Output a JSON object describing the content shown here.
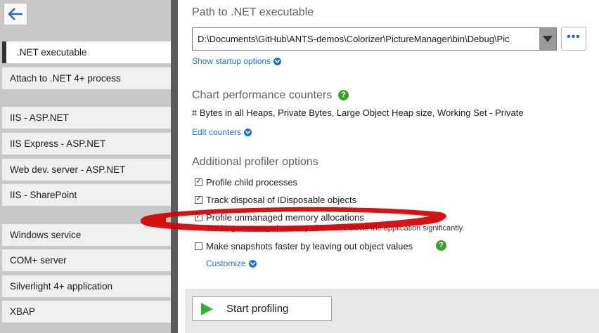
{
  "sidebar": {
    "items": [
      {
        "label": ".NET executable",
        "active": true
      },
      {
        "label": "Attach to .NET 4+ process"
      },
      {
        "label": "IIS - ASP.NET"
      },
      {
        "label": "IIS Express - ASP.NET"
      },
      {
        "label": "Web dev. server - ASP.NET"
      },
      {
        "label": "IIS - SharePoint"
      },
      {
        "label": "Windows service"
      },
      {
        "label": "COM+ server"
      },
      {
        "label": "Silverlight 4+ application"
      },
      {
        "label": "XBAP"
      }
    ]
  },
  "path_section": {
    "title": "Path to .NET executable",
    "value": "D:\\Documents\\GitHub\\ANTS-demos\\Colorizer\\PictureManager\\bin\\Debug\\Pic",
    "browse_label": "•••",
    "startup_link": "Show startup options"
  },
  "counters_section": {
    "title": "Chart performance counters",
    "help": "?",
    "text": "# Bytes in all Heaps, Private Bytes, Large Object Heap size, Working Set - Private",
    "edit_link": "Edit counters"
  },
  "options_section": {
    "title": "Additional profiler options",
    "options": [
      {
        "label": "Profile child processes",
        "checked": true
      },
      {
        "label": "Track disposal of IDisposable objects",
        "checked": true
      },
      {
        "label": "Profile unmanaged memory allocations",
        "checked": true
      },
      {
        "label": "Make snapshots faster by leaving out object values",
        "checked": false
      }
    ],
    "note": "Tracking unmanaged memory allocations slows the application significantly.",
    "help": "?",
    "customize_link": "Customize"
  },
  "footer": {
    "start_label": "Start profiling"
  },
  "colors": {
    "accent": "#1a73c9",
    "help_green": "#3aa32b",
    "play_green": "#2db52d",
    "highlight_red": "#d40000"
  }
}
